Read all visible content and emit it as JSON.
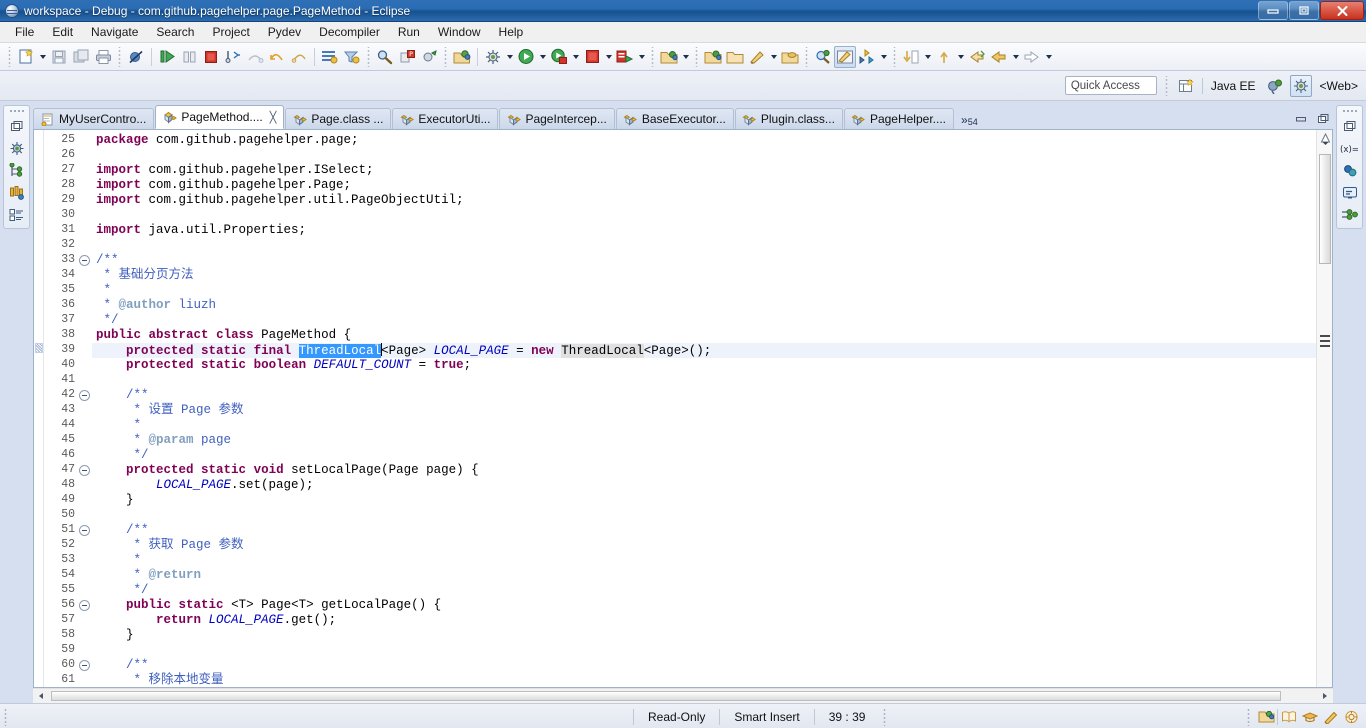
{
  "window": {
    "title": "workspace - Debug - com.github.pagehelper.page.PageMethod - Eclipse",
    "minimize_label": "–",
    "maximize_label": "❐",
    "close_label": "✕"
  },
  "menubar": {
    "items": [
      "File",
      "Edit",
      "Navigate",
      "Search",
      "Project",
      "Pydev",
      "Decompiler",
      "Run",
      "Window",
      "Help"
    ]
  },
  "quick_access": {
    "placeholder": "Quick Access",
    "value": "Quick Access"
  },
  "perspective": {
    "java_ee_label": "Java EE",
    "web_label": "<Web>"
  },
  "editor_tabs": [
    {
      "label": "MyUserContro...",
      "icon": "java-file-icon",
      "active": false,
      "closable": false
    },
    {
      "label": "PageMethod....",
      "icon": "class-file-icon",
      "active": true,
      "closable": true
    },
    {
      "label": "Page.class ...",
      "icon": "class-file-icon",
      "active": false,
      "closable": false
    },
    {
      "label": "ExecutorUti...",
      "icon": "class-file-icon",
      "active": false,
      "closable": false
    },
    {
      "label": "PageIntercep...",
      "icon": "class-file-icon",
      "active": false,
      "closable": false
    },
    {
      "label": "BaseExecutor...",
      "icon": "class-file-icon",
      "active": false,
      "closable": false
    },
    {
      "label": "Plugin.class...",
      "icon": "class-file-icon",
      "active": false,
      "closable": false
    },
    {
      "label": "PageHelper....",
      "icon": "class-file-icon",
      "active": false,
      "closable": false
    }
  ],
  "tab_overflow": {
    "chevron": "»",
    "count": "54"
  },
  "editor": {
    "first_line": 25,
    "current_line": 39,
    "selection_text": "ThreadLocal",
    "lines": [
      {
        "n": 25,
        "fold": false,
        "html": "<span class=\"kw\">package</span> com.github.pagehelper.page;"
      },
      {
        "n": 26,
        "fold": false,
        "html": ""
      },
      {
        "n": 27,
        "fold": false,
        "html": "<span class=\"kw\">import</span> com.github.pagehelper.ISelect;"
      },
      {
        "n": 28,
        "fold": false,
        "html": "<span class=\"kw\">import</span> com.github.pagehelper.Page;"
      },
      {
        "n": 29,
        "fold": false,
        "html": "<span class=\"kw\">import</span> com.github.pagehelper.util.PageObjectUtil;"
      },
      {
        "n": 30,
        "fold": false,
        "html": ""
      },
      {
        "n": 31,
        "fold": false,
        "html": "<span class=\"kw\">import</span> java.util.Properties;"
      },
      {
        "n": 32,
        "fold": false,
        "html": ""
      },
      {
        "n": 33,
        "fold": true,
        "html": "<span class=\"jdoc\">/**</span>"
      },
      {
        "n": 34,
        "fold": false,
        "html": " <span class=\"jdoc\">* 基础分页方法</span>"
      },
      {
        "n": 35,
        "fold": false,
        "html": " <span class=\"jdoc\">*</span>"
      },
      {
        "n": 36,
        "fold": false,
        "html": " <span class=\"jdoc\">* </span><span class=\"jdoctag\">@author</span><span class=\"jdoc\"> liuzh</span>"
      },
      {
        "n": 37,
        "fold": false,
        "html": " <span class=\"jdoc\">*/</span>"
      },
      {
        "n": 38,
        "fold": false,
        "html": "<span class=\"kw\">public</span> <span class=\"kw\">abstract</span> <span class=\"kw\">class</span> PageMethod {"
      },
      {
        "n": 39,
        "fold": false,
        "cur": true,
        "html": "    <span class=\"kw\">protected</span> <span class=\"kw\">static</span> <span class=\"kw\">final</span> <span class=\"sel\">ThreadLocal</span><span class=\"caret\"></span>&lt;Page&gt; <span class=\"fld\">LOCAL_PAGE</span> = <span class=\"kw\">new</span> <span class=\"occ-hl\">ThreadLocal</span>&lt;Page&gt;();"
      },
      {
        "n": 40,
        "fold": false,
        "html": "    <span class=\"kw\">protected</span> <span class=\"kw\">static</span> <span class=\"kw\">boolean</span> <span class=\"fld\">DEFAULT_COUNT</span> = <span class=\"kw\">true</span>;"
      },
      {
        "n": 41,
        "fold": false,
        "html": ""
      },
      {
        "n": 42,
        "fold": true,
        "html": "    <span class=\"jdoc\">/**</span>"
      },
      {
        "n": 43,
        "fold": false,
        "html": "     <span class=\"jdoc\">* 设置 Page 参数</span>"
      },
      {
        "n": 44,
        "fold": false,
        "html": "     <span class=\"jdoc\">*</span>"
      },
      {
        "n": 45,
        "fold": false,
        "html": "     <span class=\"jdoc\">* </span><span class=\"jdoctag\">@param</span><span class=\"jdoc\"> page</span>"
      },
      {
        "n": 46,
        "fold": false,
        "html": "     <span class=\"jdoc\">*/</span>"
      },
      {
        "n": 47,
        "fold": true,
        "html": "    <span class=\"kw\">protected</span> <span class=\"kw\">static</span> <span class=\"kw\">void</span> setLocalPage(Page page) {"
      },
      {
        "n": 48,
        "fold": false,
        "html": "        <span class=\"fld\">LOCAL_PAGE</span>.set(page);"
      },
      {
        "n": 49,
        "fold": false,
        "html": "    }"
      },
      {
        "n": 50,
        "fold": false,
        "html": ""
      },
      {
        "n": 51,
        "fold": true,
        "html": "    <span class=\"jdoc\">/**</span>"
      },
      {
        "n": 52,
        "fold": false,
        "html": "     <span class=\"jdoc\">* 获取 Page 参数</span>"
      },
      {
        "n": 53,
        "fold": false,
        "html": "     <span class=\"jdoc\">*</span>"
      },
      {
        "n": 54,
        "fold": false,
        "html": "     <span class=\"jdoc\">* </span><span class=\"jdoctag\">@return</span>"
      },
      {
        "n": 55,
        "fold": false,
        "html": "     <span class=\"jdoc\">*/</span>"
      },
      {
        "n": 56,
        "fold": true,
        "html": "    <span class=\"kw\">public</span> <span class=\"kw\">static</span> &lt;T&gt; Page&lt;T&gt; getLocalPage() {"
      },
      {
        "n": 57,
        "fold": false,
        "html": "        <span class=\"kw\">return</span> <span class=\"fld\">LOCAL_PAGE</span>.get();"
      },
      {
        "n": 58,
        "fold": false,
        "html": "    }"
      },
      {
        "n": 59,
        "fold": false,
        "html": ""
      },
      {
        "n": 60,
        "fold": true,
        "html": "    <span class=\"jdoc\">/**</span>"
      },
      {
        "n": 61,
        "fold": false,
        "html": "     <span class=\"jdoc\">* 移除本地变量</span>"
      }
    ]
  },
  "statusbar": {
    "read_only": "Read-Only",
    "insert_mode": "Smart Insert",
    "cursor_position": "39 : 39"
  },
  "left_fastview": {
    "icons": [
      "restore-view-icon",
      "debug-icon",
      "servers-icon",
      "variables-tree-icon",
      "outline-icon"
    ]
  },
  "right_fastview": {
    "icons": [
      "restore-view-icon",
      "variables-icon",
      "breakpoints-icon",
      "console-icon",
      "expressions-icon"
    ]
  },
  "colors": {
    "title_blue": "#2a6db4",
    "selection_blue": "#3399ff",
    "keyword_purple": "#7f0055",
    "javadoc_blue": "#3f5fbf",
    "field_blue": "#0000c0",
    "current_line": "#eef3fb"
  }
}
